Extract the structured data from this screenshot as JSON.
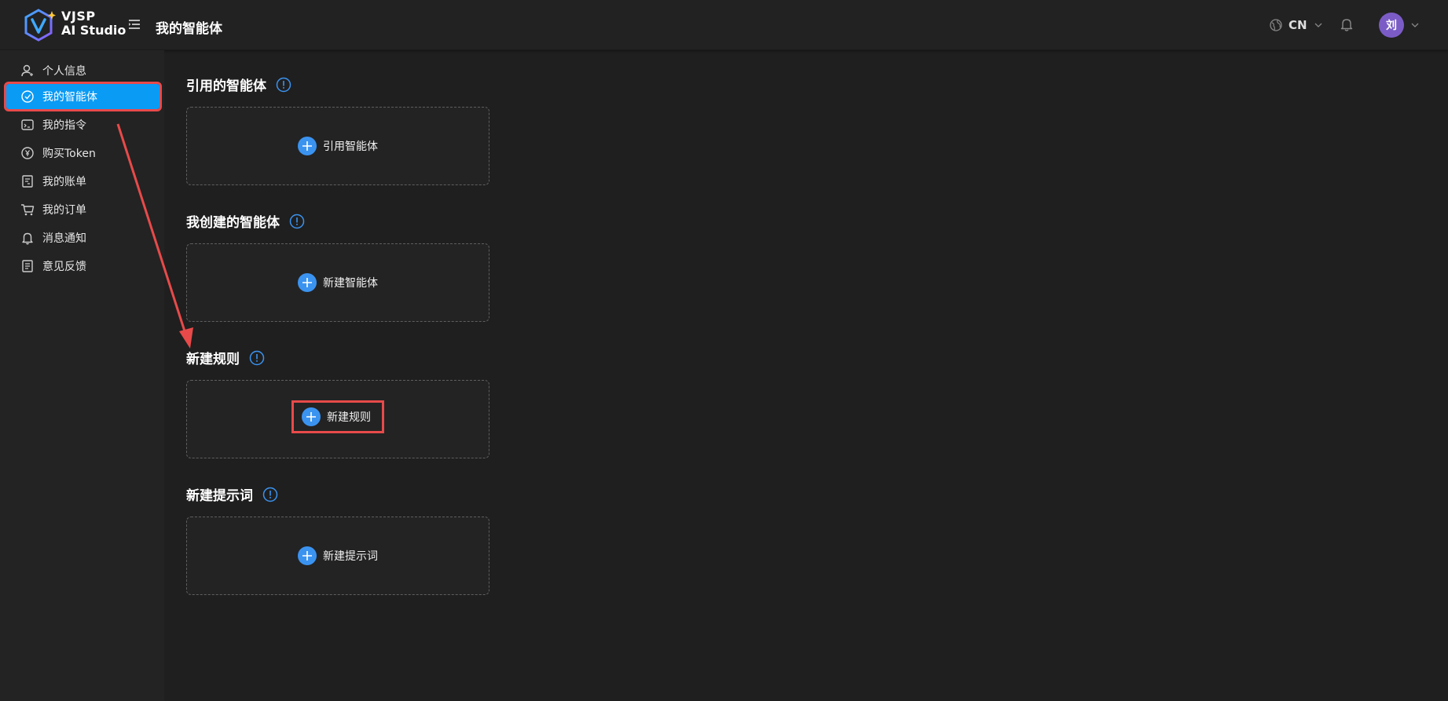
{
  "header": {
    "logo_line1": "VJSP",
    "logo_line2": "AI Studio",
    "page_title": "我的智能体",
    "language": "CN",
    "avatar_text": "刘"
  },
  "sidebar": {
    "items": [
      {
        "label": "个人信息",
        "icon": "user-icon"
      },
      {
        "label": "我的智能体",
        "icon": "agent-icon",
        "active": true
      },
      {
        "label": "我的指令",
        "icon": "command-icon"
      },
      {
        "label": "购买Token",
        "icon": "yen-coin-icon"
      },
      {
        "label": "我的账单",
        "icon": "bill-icon"
      },
      {
        "label": "我的订单",
        "icon": "cart-icon"
      },
      {
        "label": "消息通知",
        "icon": "bell-icon"
      },
      {
        "label": "意见反馈",
        "icon": "feedback-icon"
      }
    ]
  },
  "sections": [
    {
      "title": "引用的智能体",
      "button": "引用智能体"
    },
    {
      "title": "我创建的智能体",
      "button": "新建智能体"
    },
    {
      "title": "新建规则",
      "button": "新建规则"
    },
    {
      "title": "新建提示词",
      "button": "新建提示词"
    }
  ],
  "colors": {
    "accent": "#0a9bf5",
    "plus_button": "#3b93f0",
    "annotation_red": "#e84a4a",
    "avatar": "#7b5cc6"
  }
}
